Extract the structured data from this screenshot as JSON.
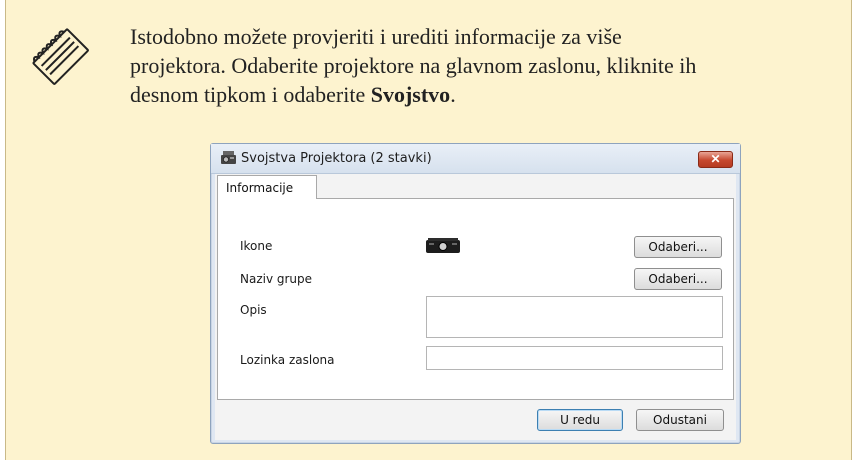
{
  "note": {
    "icon": "note-pencil-icon",
    "text_line1": "Istodobno možete provjeriti i urediti informacije za više",
    "text_line2": "projektora. Odaberite projektore na glavnom zaslonu, kliknite ih",
    "text_line3_prefix": "desnom tipkom i odaberite ",
    "text_line3_bold": "Svojstvo",
    "text_line3_suffix": "."
  },
  "dialog": {
    "title": "Svojstva Projektora (2 stavki)",
    "close_label": "✕",
    "tab_label": "Informacije",
    "fields": {
      "icon_label": "Ikone",
      "group_label": "Naziv grupe",
      "description_label": "Opis",
      "password_label": "Lozinka zaslona"
    },
    "choose_button": "Odaberi...",
    "ok_button": "U redu",
    "cancel_button": "Odustani"
  }
}
